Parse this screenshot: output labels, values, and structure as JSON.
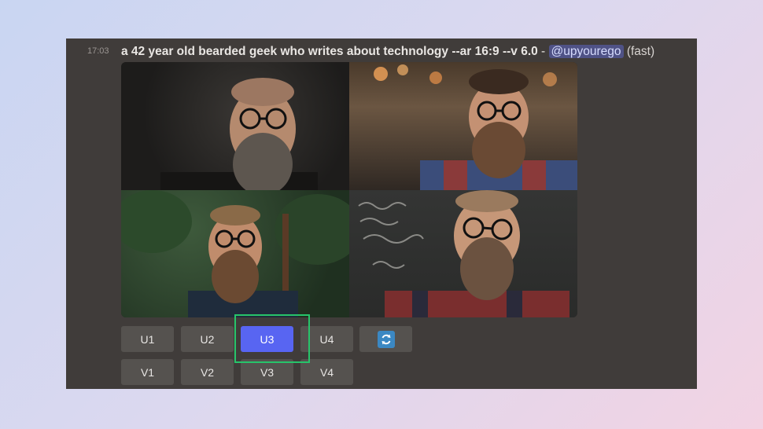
{
  "message": {
    "timestamp": "17:03",
    "prompt": "a 42 year old bearded geek who writes about technology --ar 16:9 --v 6.0",
    "separator": " - ",
    "mention": "@upyourego",
    "speed": "(fast)"
  },
  "image_grid": {
    "images": [
      {
        "description": "bearded man with glasses, dark background"
      },
      {
        "description": "bearded man with glasses in plaid shirt, cafe background"
      },
      {
        "description": "bearded man with glasses, forest background"
      },
      {
        "description": "bearded man with glasses in plaid shirt, chalkboard background"
      }
    ]
  },
  "buttons": {
    "upscale": [
      "U1",
      "U2",
      "U3",
      "U4"
    ],
    "variation": [
      "V1",
      "V2",
      "V3",
      "V4"
    ],
    "active": "U3",
    "reroll_icon": "refresh-icon"
  },
  "colors": {
    "panel": "#403c3a",
    "button": "#55524f",
    "active_button": "#5865f2",
    "highlight": "#27c46a",
    "mention_bg": "#4f5286"
  }
}
